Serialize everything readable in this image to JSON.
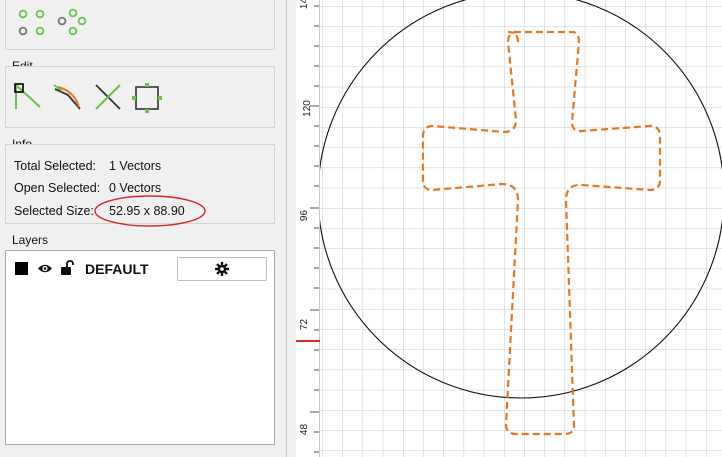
{
  "edit": {
    "title": "Edit"
  },
  "info": {
    "title": "Info",
    "rows": [
      {
        "label": "Total Selected:",
        "value": "1 Vectors"
      },
      {
        "label": "Open Selected:",
        "value": "0 Vectors"
      },
      {
        "label": "Selected Size:",
        "value": "52.95 x 88.90"
      }
    ]
  },
  "layers": {
    "title": "Layers",
    "items": [
      {
        "name": "DEFAULT",
        "visible": true,
        "locked": false,
        "color": "#000000"
      }
    ]
  },
  "ruler": {
    "labels": [
      "14",
      "120",
      "96",
      "72",
      "48"
    ]
  },
  "colors": {
    "path": "#e87722",
    "highlight": "#d9262c",
    "node_green": "#6cc24a"
  }
}
